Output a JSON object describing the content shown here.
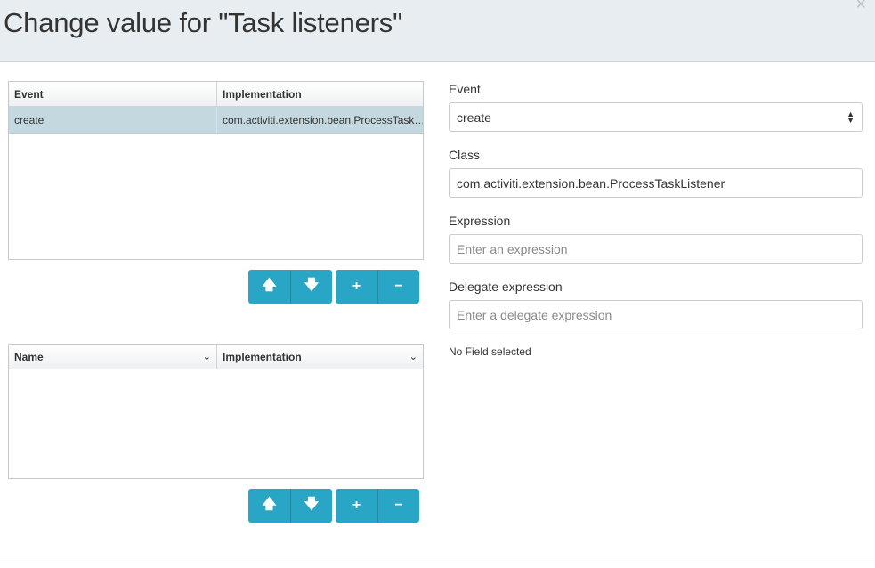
{
  "dialog": {
    "title": "Change value for \"Task listeners\"",
    "close_symbol": "×"
  },
  "listeners_grid": {
    "columns": [
      "Event",
      "Implementation"
    ],
    "rows": [
      {
        "event": "create",
        "implementation": "com.activiti.extension.bean.ProcessTask…"
      }
    ]
  },
  "fields_grid": {
    "columns": [
      "Name",
      "Implementation"
    ]
  },
  "buttons": {
    "up": "🡅",
    "down": "🡇",
    "add": "+",
    "remove": "−"
  },
  "form": {
    "event_label": "Event",
    "event_value": "create",
    "class_label": "Class",
    "class_value": "com.activiti.extension.bean.ProcessTaskListener",
    "expression_label": "Expression",
    "expression_placeholder": "Enter an expression",
    "delegate_label": "Delegate expression",
    "delegate_placeholder": "Enter a delegate expression",
    "no_field_text": "No Field selected"
  },
  "colors": {
    "accent": "#29a5c6",
    "selected_row": "#c4d8df",
    "header_bg": "#e8edf1"
  }
}
